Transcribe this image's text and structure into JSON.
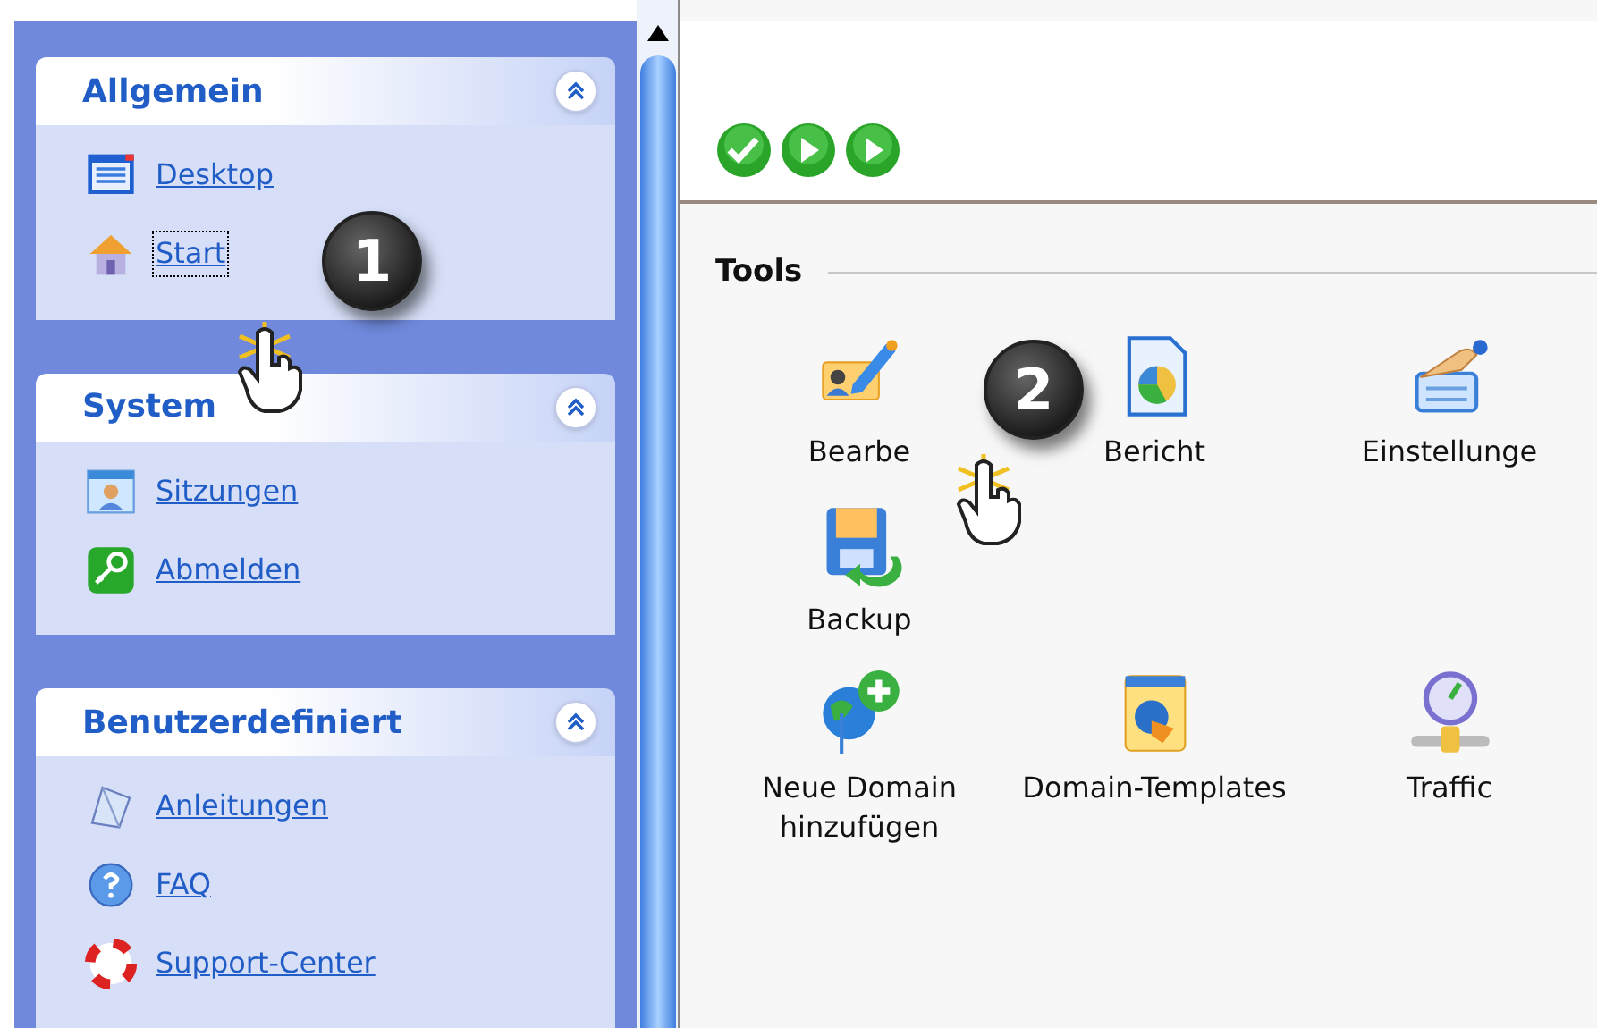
{
  "sidebar": {
    "groups": [
      {
        "title": "Allgemein",
        "expanded": true,
        "items": [
          {
            "label": "Desktop",
            "focused": false
          },
          {
            "label": "Start",
            "focused": true
          }
        ]
      },
      {
        "title": "System",
        "expanded": true,
        "items": [
          {
            "label": "Sitzungen",
            "focused": false
          },
          {
            "label": "Abmelden",
            "focused": false
          }
        ]
      },
      {
        "title": "Benutzerdefiniert",
        "expanded": true,
        "items": [
          {
            "label": "Anleitungen",
            "focused": false
          },
          {
            "label": "FAQ",
            "focused": false
          },
          {
            "label": "Support-Center",
            "focused": false
          }
        ]
      }
    ]
  },
  "toolbar": {
    "buttons": [
      {
        "kind": "check"
      },
      {
        "kind": "play"
      },
      {
        "kind": "play"
      }
    ]
  },
  "section": {
    "title": "Tools"
  },
  "tools": [
    {
      "label": "Bearbe"
    },
    {
      "label": "Bericht"
    },
    {
      "label": "Einstellunge"
    },
    {
      "label": "Backup"
    },
    {
      "label": "Neue Domain hinzufügen"
    },
    {
      "label": "Domain-Templates"
    },
    {
      "label": "Traffic"
    }
  ],
  "callouts": [
    {
      "number": "1"
    },
    {
      "number": "2"
    }
  ]
}
